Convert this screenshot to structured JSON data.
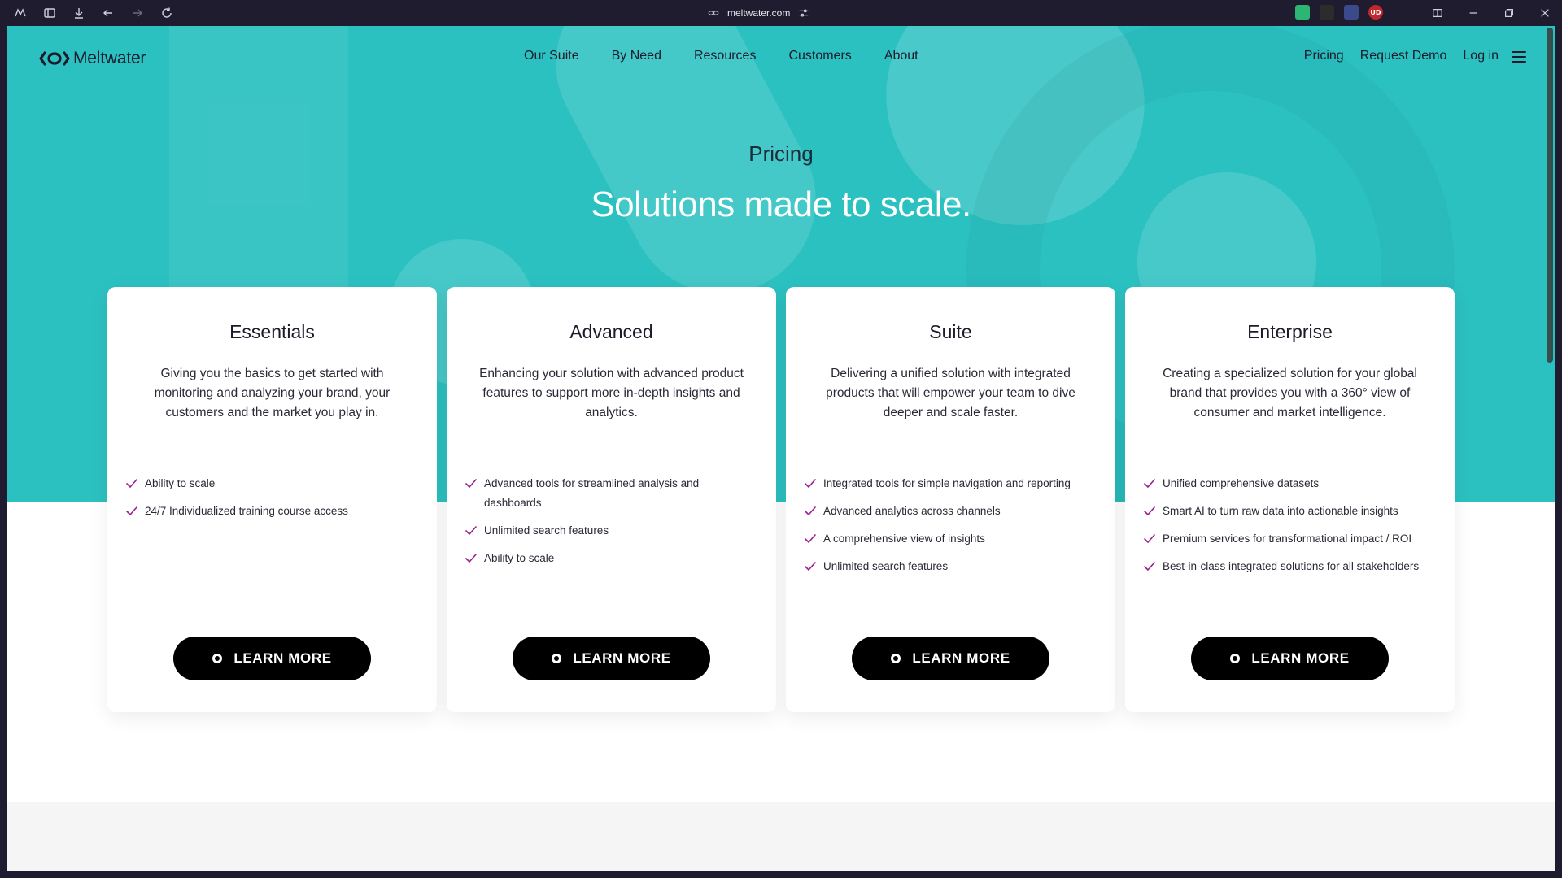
{
  "browser": {
    "url": "meltwater.com",
    "extensions": [
      {
        "name": "mail-extension-icon",
        "label": "",
        "color": "#2bb673"
      },
      {
        "name": "dark-extension-icon",
        "label": "",
        "color": "#2c2c2c"
      },
      {
        "name": "spy-extension-icon",
        "label": "",
        "color": "#3a4a8a"
      },
      {
        "name": "ublock-icon",
        "label": "UD",
        "color": "#c0282d"
      }
    ]
  },
  "site": {
    "logo_text": "Meltwater",
    "nav": {
      "items": [
        {
          "label": "Our Suite"
        },
        {
          "label": "By Need"
        },
        {
          "label": "Resources"
        },
        {
          "label": "Customers"
        },
        {
          "label": "About"
        }
      ],
      "right": {
        "pricing": "Pricing",
        "demo": "Request Demo",
        "login": "Log in"
      }
    },
    "hero": {
      "eyebrow": "Pricing",
      "headline": "Solutions made to scale.",
      "bg_color": "#2cc1c1"
    },
    "accent_check_color": "#9b1d8f",
    "plans": [
      {
        "title": "Essentials",
        "description": "Giving you the basics to get started with monitoring and analyzing your brand, your customers and the market you play in.",
        "features": [
          "Ability to scale",
          "24/7 Individualized training course access"
        ],
        "button": "LEARN MORE"
      },
      {
        "title": "Advanced",
        "description": "Enhancing your solution with advanced product features to support more in-depth insights and analytics.",
        "features": [
          "Advanced tools for streamlined analysis and dashboards",
          "Unlimited search features",
          "Ability to scale"
        ],
        "button": "LEARN MORE"
      },
      {
        "title": "Suite",
        "description": "Delivering a unified solution with integrated products that will empower your team to dive deeper and scale faster.",
        "features": [
          "Integrated tools for simple navigation and reporting",
          "Advanced analytics across channels",
          "A comprehensive view of insights",
          "Unlimited search features"
        ],
        "button": "LEARN MORE"
      },
      {
        "title": "Enterprise",
        "description": "Creating a specialized solution for your global brand that provides you with a 360° view of consumer and market intelligence.",
        "features": [
          "Unified comprehensive datasets",
          "Smart AI to turn raw data into actionable insights",
          "Premium services for transformational impact / ROI",
          "Best-in-class integrated solutions for all stakeholders"
        ],
        "button": "LEARN MORE"
      }
    ]
  }
}
